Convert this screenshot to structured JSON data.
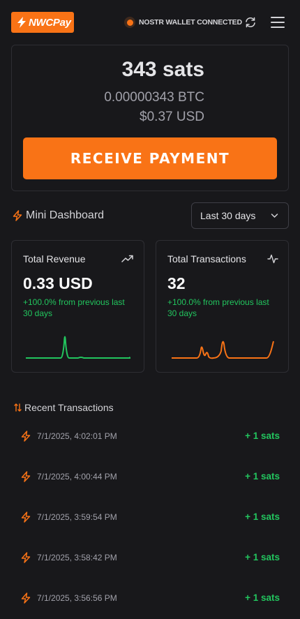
{
  "header": {
    "logo_text": "NWCPay",
    "status_text": "NOSTR WALLET CONNECTED",
    "icons": [
      "bolt-icon",
      "refresh-icon",
      "hamburger-menu-icon"
    ]
  },
  "balance": {
    "sats": "343 sats",
    "btc": "0.00000343 BTC",
    "usd": "$0.37 USD",
    "receive_label": "RECEIVE PAYMENT"
  },
  "dashboard": {
    "title": "Mini Dashboard",
    "range_selected": "Last 30 days",
    "cards": [
      {
        "label": "Total Revenue",
        "value": "0.33 USD",
        "change": "+100.0% from previous last 30 days",
        "icon": "trending-up-icon",
        "color": "#22c55e"
      },
      {
        "label": "Total Transactions",
        "value": "32",
        "change": "+100.0% from previous last 30 days",
        "icon": "activity-icon",
        "color": "#f97316"
      }
    ]
  },
  "transactions": {
    "title": "Recent Transactions",
    "items": [
      {
        "date": "7/1/2025, 4:02:01 PM",
        "amount": "+ 1 sats"
      },
      {
        "date": "7/1/2025, 4:00:44 PM",
        "amount": "+ 1 sats"
      },
      {
        "date": "7/1/2025, 3:59:54 PM",
        "amount": "+ 1 sats"
      },
      {
        "date": "7/1/2025, 3:58:42 PM",
        "amount": "+ 1 sats"
      },
      {
        "date": "7/1/2025, 3:56:56 PM",
        "amount": "+ 1 sats"
      }
    ]
  },
  "colors": {
    "accent": "#f97316",
    "positive": "#22c55e",
    "background": "#18181b"
  }
}
